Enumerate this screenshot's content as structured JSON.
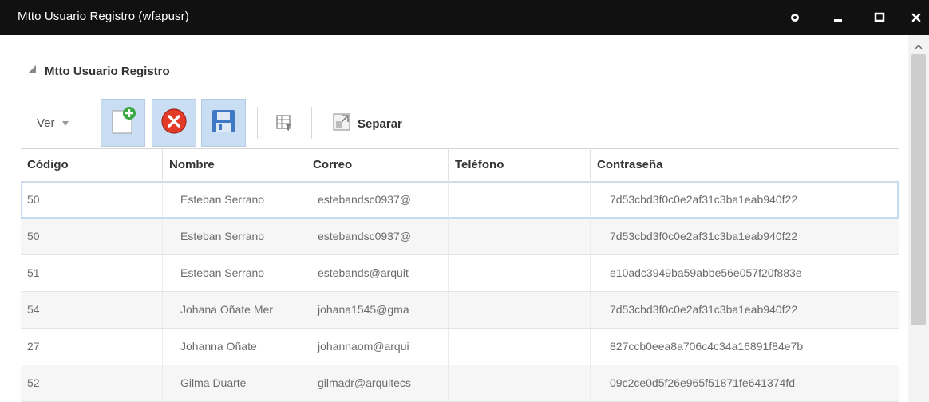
{
  "window": {
    "title": "Mtto Usuario Registro (wfapusr)",
    "controls": [
      "gear-icon",
      "minimize-icon",
      "maximize-icon",
      "close-icon"
    ]
  },
  "section": {
    "title": "Mtto Usuario Registro",
    "icon": "collapse-triangle-icon"
  },
  "toolbar": {
    "view_label": "Ver",
    "view_icon": "chevron-down-icon",
    "buttons": [
      "add-record-icon",
      "delete-record-icon",
      "save-icon",
      "query-by-example-icon"
    ],
    "detach_label": "Separar",
    "detach_icon": "detach-icon"
  },
  "table": {
    "columns": [
      "Código",
      "Nombre",
      "Correo",
      "Teléfono",
      "Contraseña"
    ],
    "rows": [
      {
        "codigo": "50",
        "nombre": "Esteban Serrano",
        "correo": "estebandsc0937@",
        "telefono": "",
        "contrasena": "7d53cbd3f0c0e2af31c3ba1eab940f22"
      },
      {
        "codigo": "50",
        "nombre": "Esteban Serrano",
        "correo": "estebandsc0937@",
        "telefono": "",
        "contrasena": "7d53cbd3f0c0e2af31c3ba1eab940f22"
      },
      {
        "codigo": "51",
        "nombre": "Esteban Serrano",
        "correo": "estebands@arquit",
        "telefono": "",
        "contrasena": "e10adc3949ba59abbe56e057f20f883e"
      },
      {
        "codigo": "54",
        "nombre": "Johana Oñate Mer",
        "correo": "johana1545@gma",
        "telefono": "",
        "contrasena": "7d53cbd3f0c0e2af31c3ba1eab940f22"
      },
      {
        "codigo": "27",
        "nombre": "Johanna Oñate",
        "correo": "johannaom@arqui",
        "telefono": "",
        "contrasena": "827ccb0eea8a706c4c34a16891f84e7b"
      },
      {
        "codigo": "52",
        "nombre": "Gilma Duarte",
        "correo": "gilmadr@arquitecs",
        "telefono": "",
        "contrasena": "09c2ce0d5f26e965f51871fe641374fd"
      }
    ]
  },
  "colors": {
    "titlebar": "#111111",
    "toolbar_button_bg": "#c9def3",
    "selected_row_border": "#c6daf0"
  }
}
